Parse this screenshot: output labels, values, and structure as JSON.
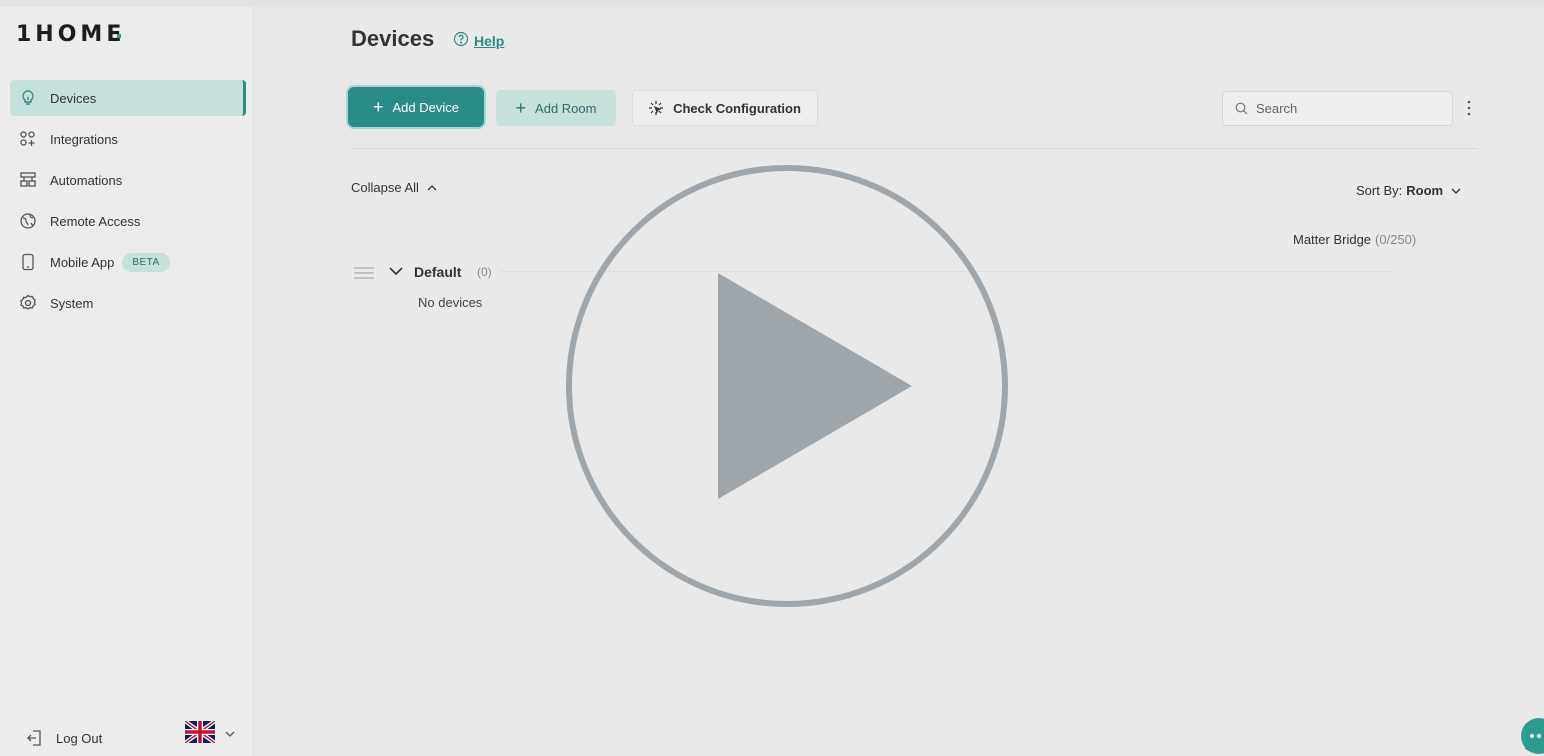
{
  "app": {
    "logo": "1HOME"
  },
  "sidebar": {
    "items": [
      {
        "label": "Devices",
        "icon": "bulb-icon",
        "active": true
      },
      {
        "label": "Integrations",
        "icon": "grid-plus-icon"
      },
      {
        "label": "Automations",
        "icon": "flow-icon"
      },
      {
        "label": "Remote Access",
        "icon": "globe-icon"
      },
      {
        "label": "Mobile App",
        "icon": "phone-icon",
        "badge": "BETA"
      },
      {
        "label": "System",
        "icon": "gear-icon"
      }
    ],
    "logout_label": "Log Out",
    "language_icon": "uk-flag-icon"
  },
  "main": {
    "title": "Devices",
    "help_label": "Help",
    "toolbar": {
      "add_device": "Add Device",
      "add_room": "Add Room",
      "check_config": "Check Configuration",
      "search_placeholder": "Search"
    },
    "collapse_label": "Collapse All",
    "sort": {
      "label": "Sort By:",
      "value": "Room"
    },
    "matter_bridge": {
      "label": "Matter Bridge",
      "count": "(0/250)"
    },
    "rooms": [
      {
        "name": "Default",
        "count": "(0)",
        "empty_text": "No devices"
      }
    ]
  },
  "overlay": {
    "icon": "play-icon"
  },
  "colors": {
    "accent": "#2a8c86",
    "accent_light": "#c6e0dc",
    "overlay": "#9ea5ab"
  }
}
